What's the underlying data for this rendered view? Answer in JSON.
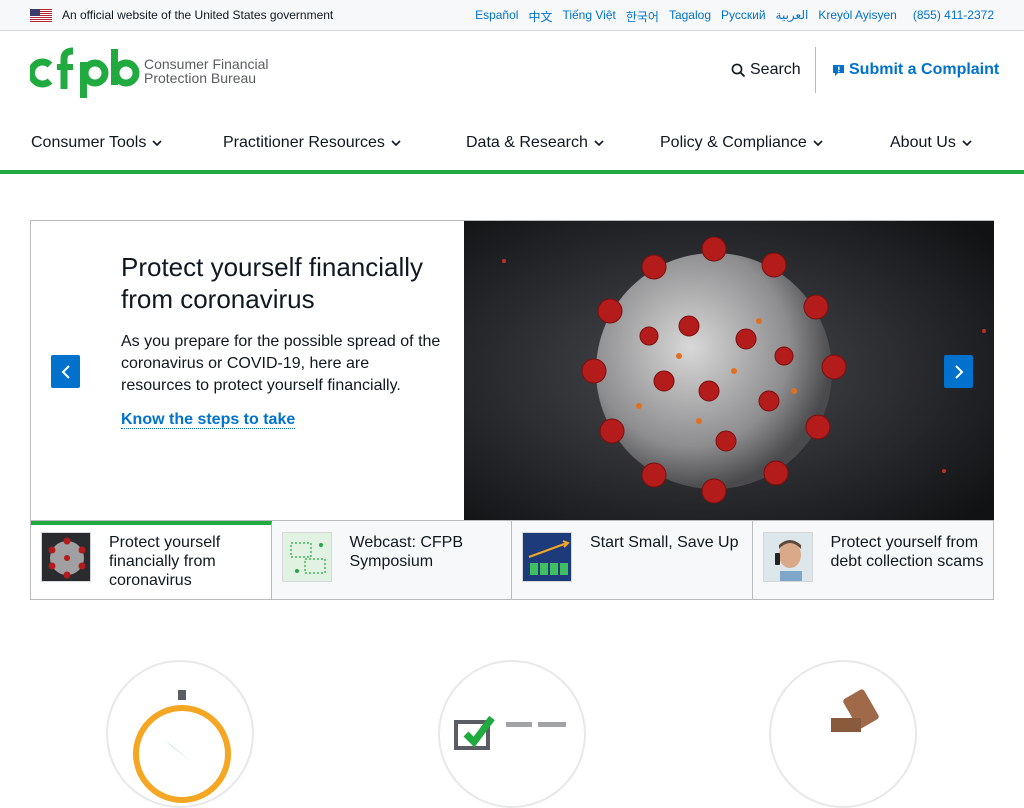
{
  "banner": {
    "official_text": "An official website of the United States government",
    "languages": [
      "Español",
      "中文",
      "Tiếng Việt",
      "한국어",
      "Tagalog",
      "Русский",
      "العربية",
      "Kreyòl Ayisyen"
    ],
    "phone": "(855) 411-2372"
  },
  "header": {
    "logo_mark": "cfpb",
    "logo_line1": "Consumer Financial",
    "logo_line2": "Protection Bureau",
    "search_label": "Search",
    "complaint_label": "Submit a Complaint"
  },
  "nav": {
    "items": [
      "Consumer Tools",
      "Practitioner Resources",
      "Data & Research",
      "Policy & Compliance",
      "About Us"
    ]
  },
  "hero": {
    "title": "Protect yourself financially from coronavirus",
    "body": "As you prepare for the possible spread of the coronavirus or COVID-19, here are resources to protect yourself financially.",
    "link_label": "Know the steps to take"
  },
  "thumbs": [
    {
      "label": "Protect yourself financially from coronavirus",
      "active": true
    },
    {
      "label": "Webcast: CFPB Symposium",
      "active": false
    },
    {
      "label": "Start Small, Save Up",
      "active": false
    },
    {
      "label": "Protect yourself from debt collection scams",
      "active": false
    }
  ],
  "colors": {
    "brand_green": "#20aa3f",
    "link_blue": "#0072ce",
    "text": "#101820"
  }
}
